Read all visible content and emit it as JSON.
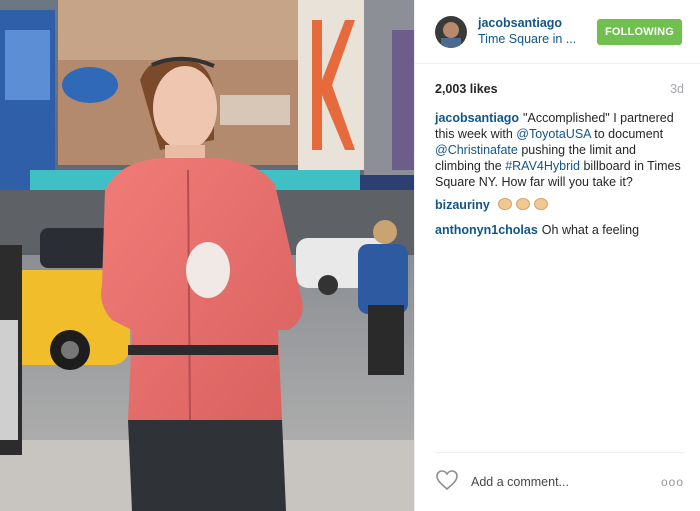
{
  "header": {
    "username": "jacobsantiago",
    "location": "Time Square in ...",
    "follow_label": "FOLLOWING"
  },
  "stats": {
    "likes": "2,003 likes",
    "time": "3d"
  },
  "caption": {
    "user": "jacobsantiago",
    "t1": "\"Accomplished\" I partnered this week with ",
    "m1": "@ToyotaUSA",
    "t2": " to document ",
    "m2": "@Christinafate",
    "t3": " pushing the limit and climbing the ",
    "h1": "#RAV4Hybrid",
    "t4": " billboard in Times Square NY. How far will you take it?"
  },
  "comments": [
    {
      "user": "bizauriny",
      "text": ""
    },
    {
      "user": "anthonyn1cholas",
      "text": "Oh what a feeling"
    }
  ],
  "footer": {
    "add_comment": "Add a comment...",
    "more": "ooo"
  },
  "colors": {
    "follow_green": "#70c050",
    "link_blue": "#125688"
  },
  "icons": [
    "heart-icon",
    "clap-emoji",
    "more-options-icon"
  ]
}
